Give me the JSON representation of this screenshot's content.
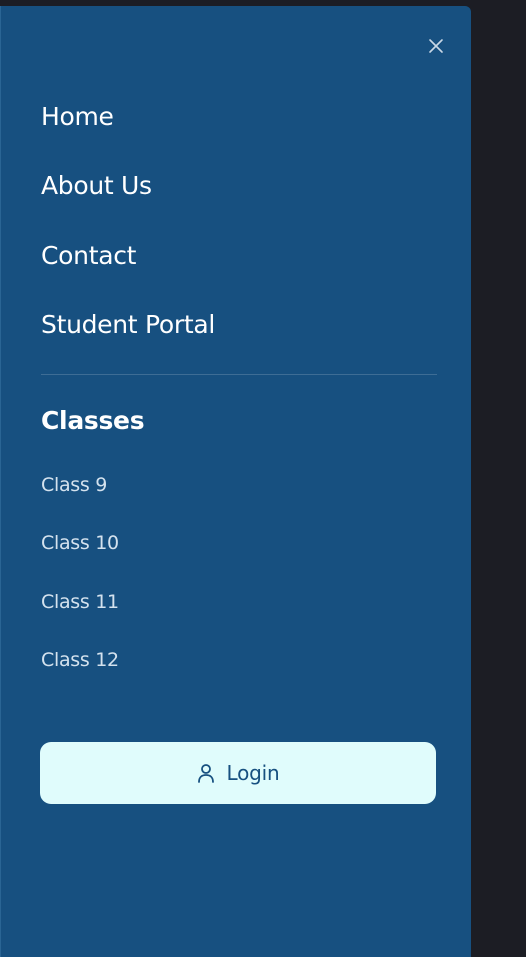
{
  "drawer": {
    "close_icon": "close-icon",
    "nav_links": [
      {
        "label": "Home"
      },
      {
        "label": "About Us"
      },
      {
        "label": "Contact"
      },
      {
        "label": "Student Portal"
      }
    ],
    "classes_heading": "Classes",
    "classes": [
      {
        "label": "Class 9"
      },
      {
        "label": "Class 10"
      },
      {
        "label": "Class 11"
      },
      {
        "label": "Class 12"
      }
    ],
    "login": {
      "label": "Login",
      "icon": "user-icon"
    }
  },
  "colors": {
    "drawer_bg": "#175080",
    "page_bg": "#1c1d24",
    "login_bg": "#e0fcfc",
    "text_primary": "#ffffff",
    "text_secondary": "#d4e2ee"
  }
}
